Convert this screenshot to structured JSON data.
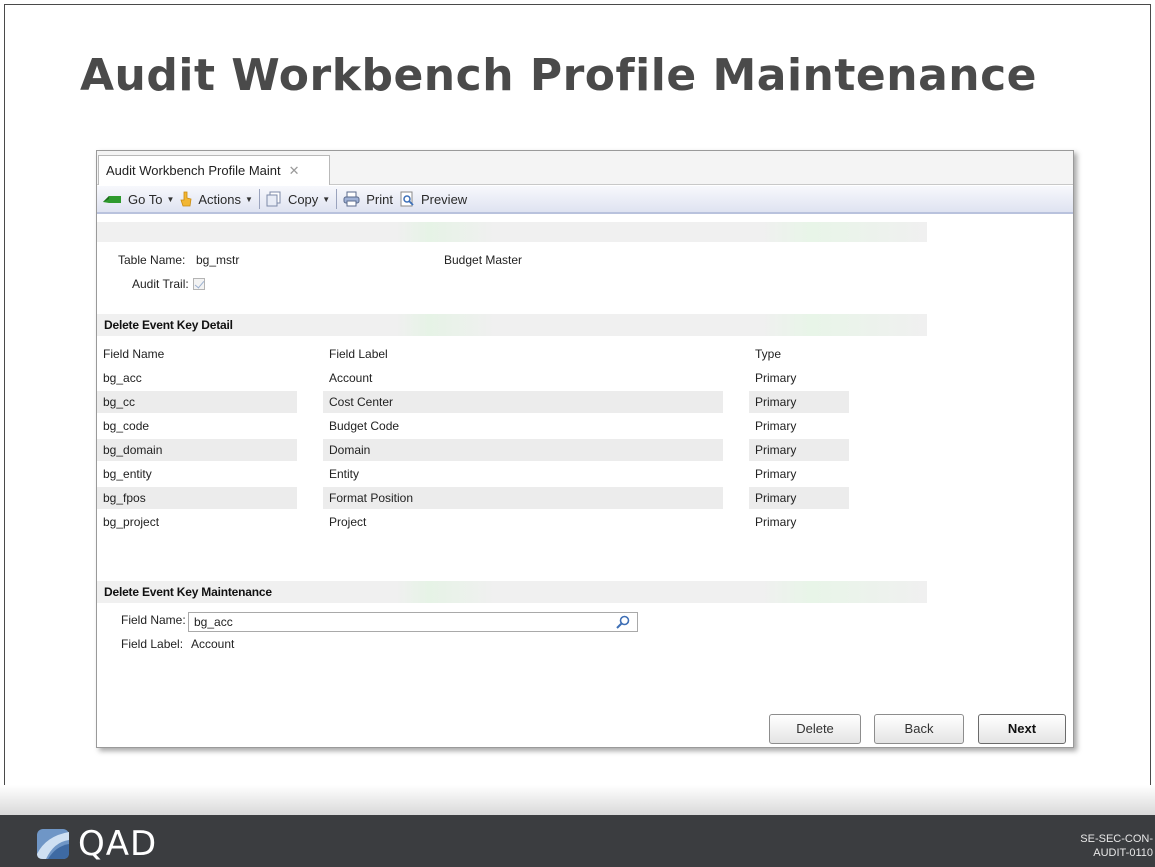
{
  "slide": {
    "title": "Audit Workbench Profile Maintenance",
    "brand": "QAD",
    "code_line1": "SE-SEC-CON-",
    "code_line2": "AUDIT-0110"
  },
  "tab": {
    "label": "Audit Workbench Profile Maint",
    "close_glyph": "✕"
  },
  "toolbar": {
    "goto": "Go To",
    "actions": "Actions",
    "copy": "Copy",
    "print": "Print",
    "preview": "Preview"
  },
  "header": {
    "table_name_label": "Table Name:",
    "table_name_value": "bg_mstr",
    "table_desc": "Budget Master",
    "audit_trail_label": "Audit Trail:",
    "audit_trail_checked": true
  },
  "detail": {
    "section_title": "Delete Event Key Detail",
    "columns": [
      "Field Name",
      "Field Label",
      "Type"
    ],
    "rows": [
      [
        "bg_acc",
        "Account",
        "Primary"
      ],
      [
        "bg_cc",
        "Cost Center",
        "Primary"
      ],
      [
        "bg_code",
        "Budget Code",
        "Primary"
      ],
      [
        "bg_domain",
        "Domain",
        "Primary"
      ],
      [
        "bg_entity",
        "Entity",
        "Primary"
      ],
      [
        "bg_fpos",
        "Format Position",
        "Primary"
      ],
      [
        "bg_project",
        "Project",
        "Primary"
      ]
    ]
  },
  "maintenance": {
    "section_title": "Delete Event Key Maintenance",
    "field_name_label": "Field Name:",
    "field_name_value": "bg_acc",
    "field_label_label": "Field Label:",
    "field_label_value": "Account"
  },
  "buttons": {
    "delete": "Delete",
    "back": "Back",
    "next": "Next"
  },
  "colors": {
    "title": "#4a4a4a",
    "footer": "#3b3d40",
    "toolbar_border": "#b9c2dd"
  }
}
